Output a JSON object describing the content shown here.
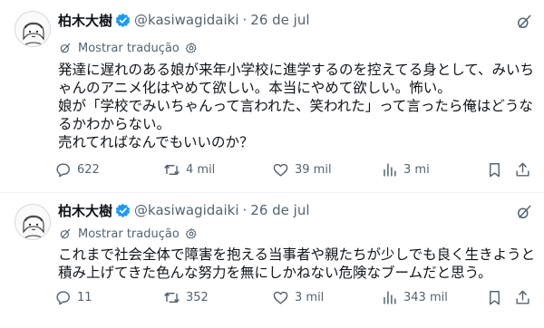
{
  "tweets": [
    {
      "author_name": "柏木大樹",
      "handle": "@kasiwagidaiki",
      "separator": "·",
      "date": "26 de jul",
      "translate_label": "Mostrar tradução",
      "text_lines": [
        "発達に遅れのある娘が来年小学校に進学するのを控えてる身として、みいち",
        "ゃんのアニメ化はやめて欲しい。本当にやめて欲しい。怖い。",
        "娘が「学校でみいちゃんって言われた、笑われた」って言ったら俺はどうな",
        "るかわからない。",
        "売れてればなんでもいいのか？"
      ],
      "replies": "622",
      "reposts": "4 mil",
      "likes": "39 mil",
      "views": "3 mi"
    },
    {
      "author_name": "柏木大樹",
      "handle": "@kasiwagidaiki",
      "separator": "·",
      "date": "26 de jul",
      "translate_label": "Mostrar tradução",
      "text_lines": [
        "これまで社会全体で障害を抱える当事者や親たちが少しでも良く生きようと",
        "積み上げてきた色んな努力を無にしかねない危険なブームだと思う。"
      ],
      "replies": "11",
      "reposts": "352",
      "likes": "3 mil",
      "views": "343 mil"
    }
  ],
  "colors": {
    "text": "#0f1419",
    "secondary": "#536471",
    "verified": "#1d9bf0",
    "divider": "#eff3f4"
  },
  "icons": [
    "verified-badge-icon",
    "grok-icon",
    "translate-icon",
    "gear-icon",
    "reply-icon",
    "repost-icon",
    "like-icon",
    "views-icon",
    "bookmark-icon",
    "share-icon"
  ]
}
